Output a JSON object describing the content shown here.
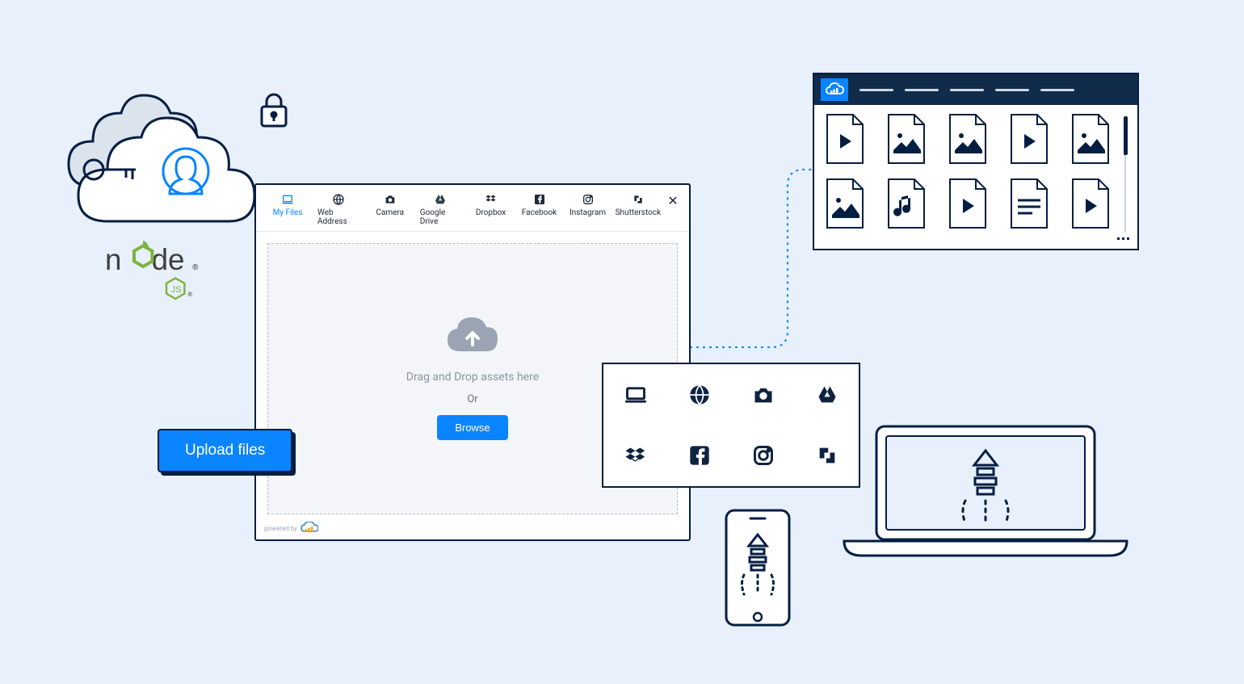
{
  "upload_button_label": "Upload files",
  "nodejs": {
    "word": "node",
    "suffix": "JS"
  },
  "widget": {
    "tabs": [
      {
        "id": "my-files",
        "label": "My Files",
        "icon": "laptop",
        "active": true
      },
      {
        "id": "web-address",
        "label": "Web Address",
        "icon": "globe",
        "active": false
      },
      {
        "id": "camera",
        "label": "Camera",
        "icon": "camera",
        "active": false
      },
      {
        "id": "google-drive",
        "label": "Google Drive",
        "icon": "gdrive",
        "active": false
      },
      {
        "id": "dropbox",
        "label": "Dropbox",
        "icon": "dropbox",
        "active": false
      },
      {
        "id": "facebook",
        "label": "Facebook",
        "icon": "facebook",
        "active": false
      },
      {
        "id": "instagram",
        "label": "Instagram",
        "icon": "instagram",
        "active": false
      },
      {
        "id": "shutterstock",
        "label": "Shutterstock",
        "icon": "shutterstock",
        "active": false
      }
    ],
    "dropzone": {
      "hint": "Drag and Drop assets here",
      "or": "Or",
      "browse": "Browse"
    },
    "powered_by": "powered by"
  },
  "sources_grid": [
    "laptop",
    "globe",
    "camera",
    "gdrive",
    "dropbox",
    "facebook",
    "instagram",
    "shutterstock"
  ],
  "library": {
    "files": [
      "video",
      "image",
      "image",
      "video",
      "image",
      "image",
      "audio",
      "video",
      "text",
      "video"
    ]
  },
  "colors": {
    "accent": "#0a84ff",
    "navy": "#0f2340",
    "outline": "#041e42",
    "bg": "#e7f0fb"
  }
}
